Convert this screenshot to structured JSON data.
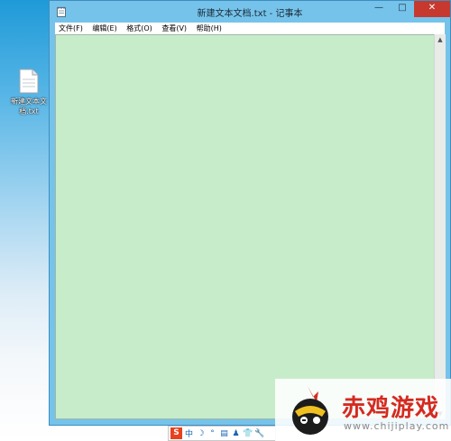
{
  "desktop": {
    "icon_label": "新建文本文档.txt",
    "icon_name": "text-file-icon"
  },
  "window": {
    "title": "新建文本文档.txt - 记事本",
    "controls": {
      "minimize": "—",
      "maximize": "□",
      "close": "✕"
    }
  },
  "menubar": {
    "items": [
      {
        "label": "文件(F)"
      },
      {
        "label": "编辑(E)"
      },
      {
        "label": "格式(O)"
      },
      {
        "label": "查看(V)"
      },
      {
        "label": "帮助(H)"
      }
    ]
  },
  "editor": {
    "content": "",
    "background": "#c7ecca"
  },
  "ime_bar": {
    "logo": "S",
    "items": [
      "中",
      "☽",
      "°",
      "▤",
      "♟",
      "👕",
      "🔧"
    ]
  },
  "watermark": {
    "text": "赤鸡游戏",
    "subtext": "www.chijiplay.com",
    "color": "#d52a20"
  }
}
